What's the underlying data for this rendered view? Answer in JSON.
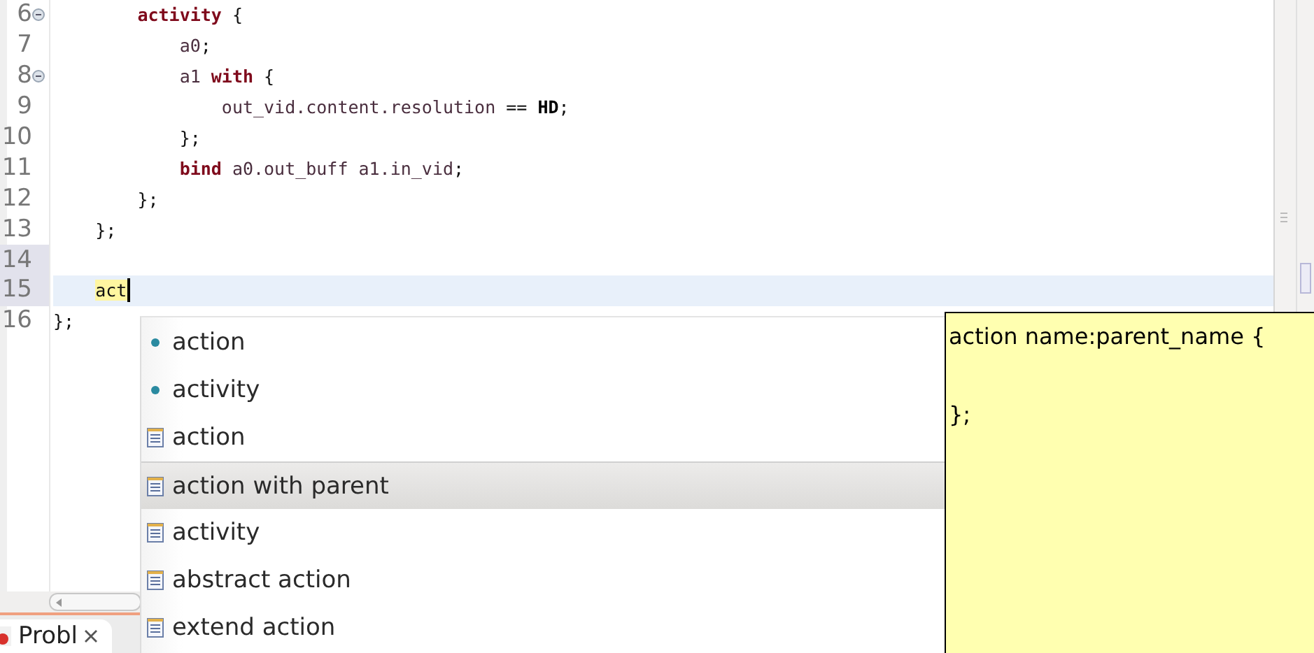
{
  "editor": {
    "lines": [
      {
        "number": "6",
        "fold": true,
        "highlighted": false,
        "current": false,
        "tokens": [
          {
            "text": "        activity",
            "kind": "keyword"
          },
          {
            "text": " {",
            "kind": "plain"
          }
        ]
      },
      {
        "number": "7",
        "fold": false,
        "highlighted": false,
        "current": false,
        "tokens": [
          {
            "text": "            a0",
            "kind": "ident"
          },
          {
            "text": ";",
            "kind": "plain"
          }
        ]
      },
      {
        "number": "8",
        "fold": true,
        "highlighted": false,
        "current": false,
        "tokens": [
          {
            "text": "            a1",
            "kind": "ident"
          },
          {
            "text": " with",
            "kind": "keyword"
          },
          {
            "text": " {",
            "kind": "plain"
          }
        ]
      },
      {
        "number": "9",
        "fold": false,
        "highlighted": false,
        "current": false,
        "tokens": [
          {
            "text": "                out_vid.content.resolution",
            "kind": "ident"
          },
          {
            "text": " ==",
            "kind": "plain"
          },
          {
            "text": " HD",
            "kind": "bold"
          },
          {
            "text": ";",
            "kind": "plain"
          }
        ]
      },
      {
        "number": "10",
        "fold": false,
        "highlighted": false,
        "current": false,
        "tokens": [
          {
            "text": "            };",
            "kind": "plain"
          }
        ]
      },
      {
        "number": "11",
        "fold": false,
        "highlighted": false,
        "current": false,
        "tokens": [
          {
            "text": "            bind",
            "kind": "keyword"
          },
          {
            "text": " a0.out_buff a1.in_vid",
            "kind": "ident"
          },
          {
            "text": ";",
            "kind": "plain"
          }
        ]
      },
      {
        "number": "12",
        "fold": false,
        "highlighted": false,
        "current": false,
        "tokens": [
          {
            "text": "        };",
            "kind": "plain"
          }
        ]
      },
      {
        "number": "13",
        "fold": false,
        "highlighted": false,
        "current": false,
        "tokens": [
          {
            "text": "    };",
            "kind": "plain"
          }
        ]
      },
      {
        "number": "14",
        "fold": false,
        "highlighted": true,
        "current": false
      },
      {
        "number": "15",
        "fold": false,
        "highlighted": true,
        "current": true,
        "tokens": [
          {
            "text": "    act",
            "kind": "match"
          }
        ]
      },
      {
        "number": "16",
        "fold": false,
        "highlighted": false,
        "current": false,
        "tokens": [
          {
            "text": "};",
            "kind": "plain"
          }
        ]
      }
    ]
  },
  "completion": {
    "items": [
      {
        "label": "action",
        "kind": "keyword",
        "selected": false
      },
      {
        "label": "activity",
        "kind": "keyword",
        "selected": false
      },
      {
        "label": "action",
        "kind": "template",
        "selected": false
      },
      {
        "label": "action with parent",
        "kind": "template",
        "selected": true
      },
      {
        "label": "activity",
        "kind": "template",
        "selected": false
      },
      {
        "label": "abstract action",
        "kind": "template",
        "selected": false
      },
      {
        "label": "extend action",
        "kind": "template",
        "selected": false
      }
    ],
    "preview": "action name:parent_name {\n\n};"
  },
  "bottom_tabs": [
    {
      "label": "Probl"
    }
  ]
}
